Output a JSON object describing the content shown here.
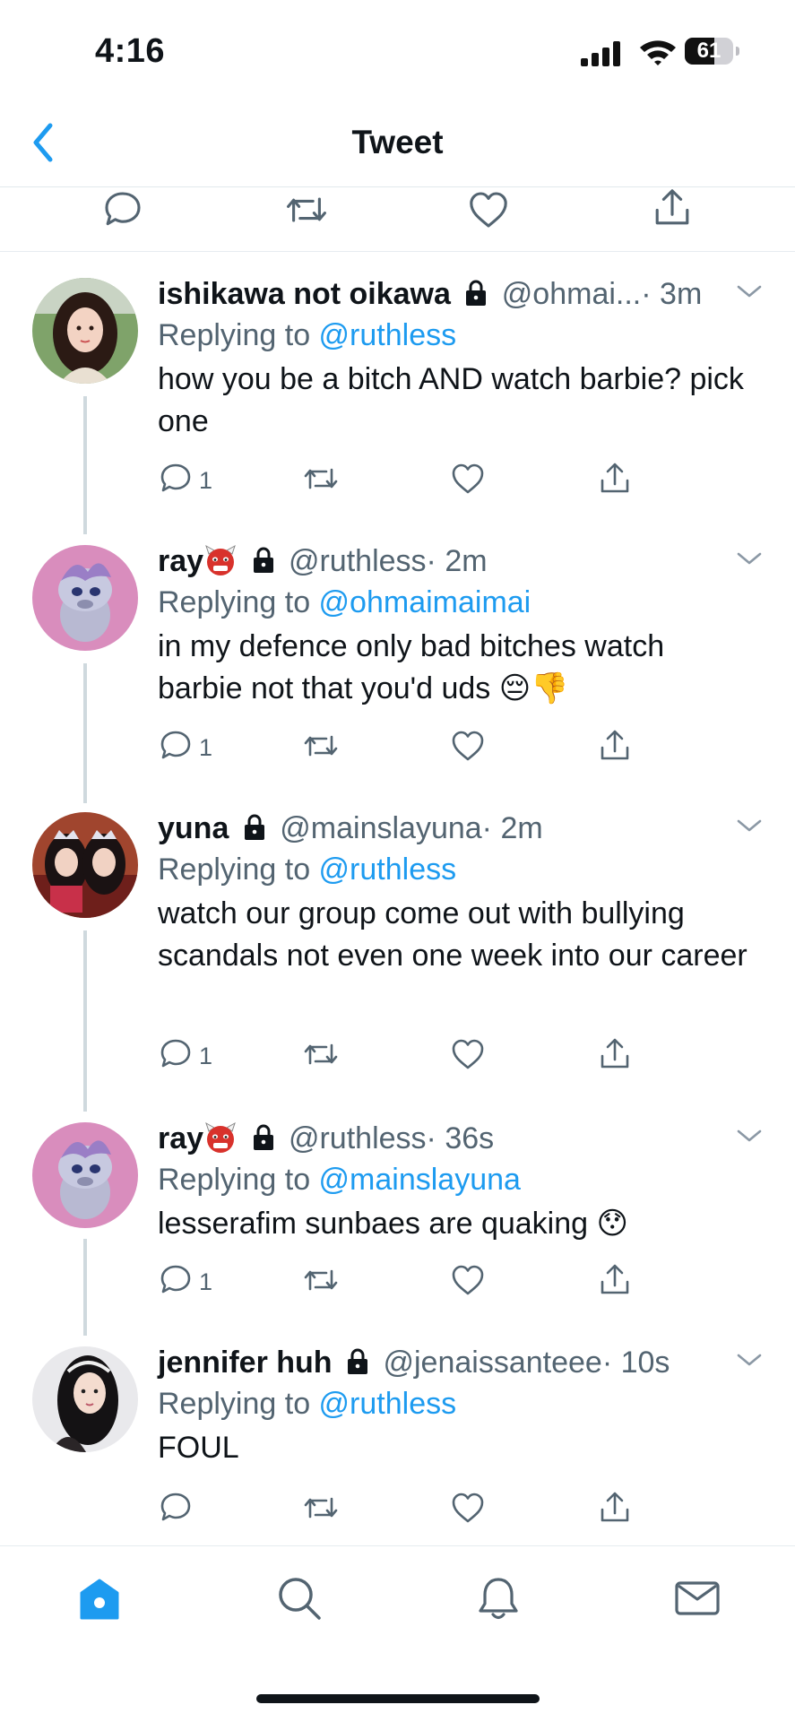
{
  "status_bar": {
    "time": "4:16",
    "battery": "61",
    "battery_level": 0.61
  },
  "header": {
    "title": "Tweet",
    "back_icon": "chevron-left-icon"
  },
  "colors": {
    "accent": "#1d9bf0",
    "secondary_text": "#536471",
    "primary_text": "#0f1419"
  },
  "replies": [
    {
      "name": "ishikawa not oikawa",
      "locked": true,
      "handle": "@ohmai...",
      "time": "· 3m",
      "replying_prefix": "Replying to ",
      "replying_to": "@ruthless",
      "text": "how you be a bitch AND watch barbie? pick one",
      "reply_count": "1"
    },
    {
      "name": "ray",
      "locked": true,
      "handle": "@ruthless",
      "time": "· 2m",
      "replying_prefix": "Replying to ",
      "replying_to": "@ohmaimaimai",
      "text": "in my defence only bad bitches watch barbie not that you'd uds 😔👎",
      "reply_count": "1"
    },
    {
      "name": "yuna",
      "locked": true,
      "handle": "@mainslayuna",
      "time": "· 2m",
      "replying_prefix": "Replying to ",
      "replying_to": "@ruthless",
      "text": "watch our group come out with bullying scandals not even one week into our career",
      "reply_count": "1"
    },
    {
      "name": "ray",
      "locked": true,
      "handle": "@ruthless",
      "time": "· 36s",
      "replying_prefix": "Replying to ",
      "replying_to": "@mainslayuna",
      "text": "lesserafim sunbaes are quaking 😯",
      "reply_count": "1"
    },
    {
      "name": "jennifer huh",
      "locked": true,
      "handle": "@jenaissanteee",
      "time": "· 10s",
      "replying_prefix": "Replying to ",
      "replying_to": "@ruthless",
      "text": "FOUL",
      "reply_count": ""
    }
  ],
  "tabbar": {
    "items": [
      "home-icon",
      "search-icon",
      "notifications-bell-icon",
      "messages-envelope-icon"
    ],
    "active": "home-icon"
  }
}
